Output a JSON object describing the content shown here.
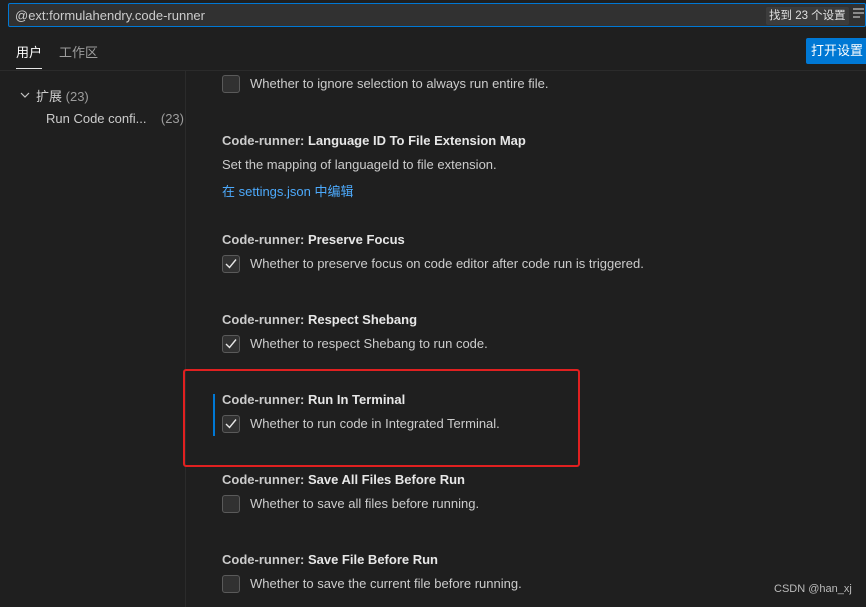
{
  "search": {
    "value": "@ext:formulahendry.code-runner",
    "result_count": "找到 23 个设置",
    "filter_icon": "filter-icon"
  },
  "tabs": [
    {
      "label": "用户",
      "active": true
    },
    {
      "label": "工作区",
      "active": false
    }
  ],
  "open_settings_json_label": "打开设置",
  "toc": {
    "group_label": "扩展",
    "group_count": "(23)",
    "sub_label": "Run Code confi...",
    "sub_count": "(23)"
  },
  "settings": [
    {
      "category": "",
      "name": "",
      "description": "Whether to ignore selection to always run entire file.",
      "checked": false
    },
    {
      "category": "Code-runner: ",
      "name": "Language ID To File Extension Map",
      "description": "Set the mapping of languageId to file extension.",
      "link": "在 settings.json 中编辑"
    },
    {
      "category": "Code-runner: ",
      "name": "Preserve Focus",
      "description": "Whether to preserve focus on code editor after code run is triggered.",
      "checked": true
    },
    {
      "category": "Code-runner: ",
      "name": "Respect Shebang",
      "description": "Whether to respect Shebang to run code.",
      "checked": true
    },
    {
      "category": "Code-runner: ",
      "name": "Run In Terminal",
      "description": "Whether to run code in Integrated Terminal.",
      "checked": true,
      "focused": true
    },
    {
      "category": "Code-runner: ",
      "name": "Save All Files Before Run",
      "description": "Whether to save all files before running.",
      "checked": false
    },
    {
      "category": "Code-runner: ",
      "name": "Save File Before Run",
      "description": "Whether to save the current file before running.",
      "checked": false
    }
  ],
  "watermark": "CSDN @han_xj",
  "colors": {
    "accent": "#0078d4",
    "link": "#4daafc",
    "annotation": "#e02020",
    "background": "#1f1f1f"
  }
}
